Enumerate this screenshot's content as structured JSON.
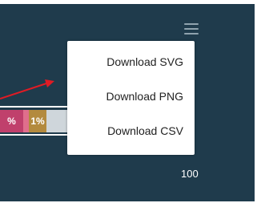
{
  "menu": {
    "items": [
      {
        "label": "Download SVG"
      },
      {
        "label": "Download PNG"
      },
      {
        "label": "Download CSV"
      }
    ]
  },
  "bar": {
    "segments": [
      {
        "label": "%",
        "color": "#c0406c"
      },
      {
        "label": "",
        "color": "#e06f8c"
      },
      {
        "label": "1%",
        "color": "#b38a3e"
      }
    ]
  },
  "axis": {
    "tick_label": "100"
  },
  "colors": {
    "background": "#1f3b4c",
    "arrow": "#e01b24",
    "menu_bg": "#ffffff"
  },
  "icons": {
    "menu_button": "hamburger-icon"
  }
}
